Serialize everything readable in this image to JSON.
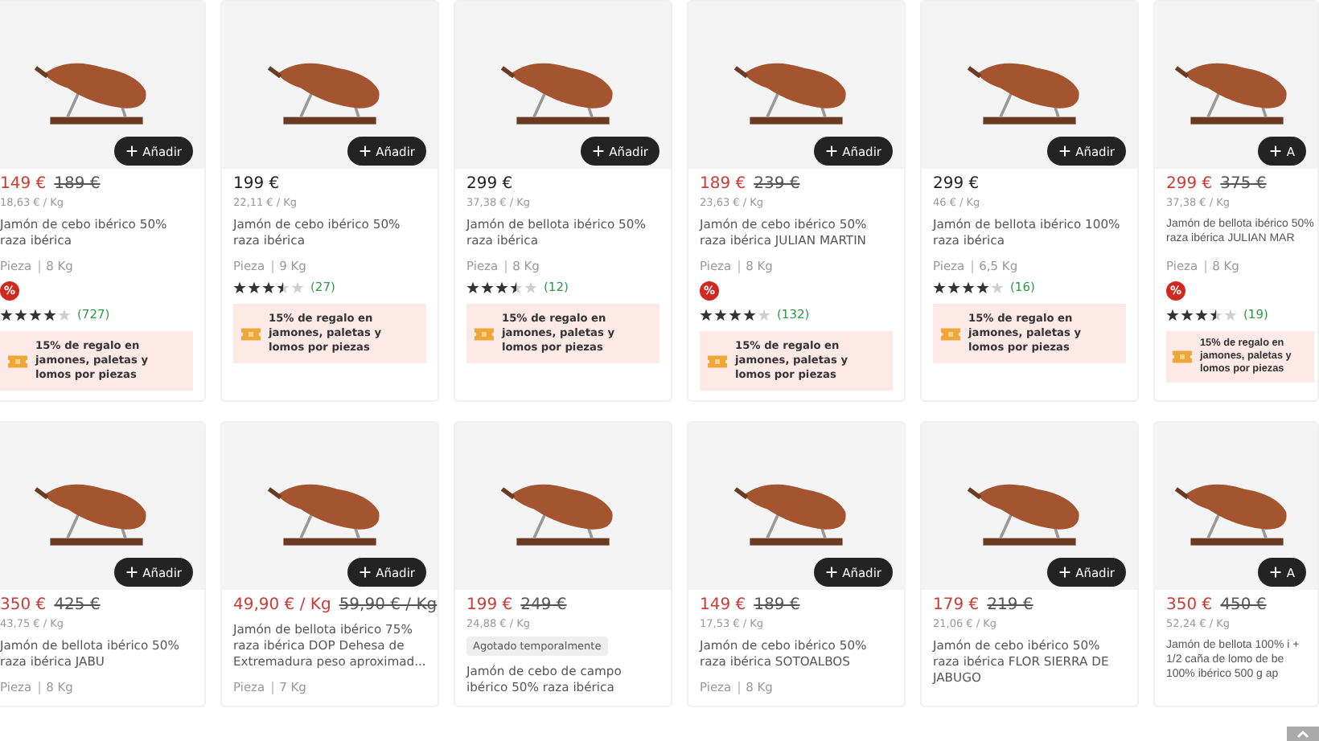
{
  "rows": [
    {
      "products": [
        {
          "price": "149 €",
          "old_price": "189 €",
          "unit_price": "18,63 € / Kg",
          "name": "Jamón de cebo ibérico 50% raza ibérica",
          "weight_label": "Pieza",
          "weight": "8 Kg",
          "discount_badge": "%",
          "stars": 4,
          "reviews": "(727)",
          "promo": "15% de regalo en jamones, paletas y lomos por piezas",
          "add_button": "Añadir"
        },
        {
          "price": "199 €",
          "unit_price": "22,11 € / Kg",
          "name": "Jamón de cebo ibérico 50% raza ibérica",
          "weight_label": "Pieza",
          "weight": "9 Kg",
          "stars": 3.5,
          "reviews": "(27)",
          "promo": "15% de regalo en jamones, paletas y lomos por piezas",
          "add_button": "Añadir"
        },
        {
          "price": "299 €",
          "unit_price": "37,38 € / Kg",
          "name": "Jamón de bellota ibérico 50% raza ibérica",
          "weight_label": "Pieza",
          "weight": "8 Kg",
          "stars": 3.5,
          "reviews": "(12)",
          "promo": "15% de regalo en jamones, paletas y lomos por piezas",
          "add_button": "Añadir"
        },
        {
          "price": "189 €",
          "old_price": "239 €",
          "unit_price": "23,63 € / Kg",
          "name": "Jamón de cebo ibérico 50% raza ibérica JULIAN MARTIN",
          "weight_label": "Pieza",
          "weight": "8 Kg",
          "discount_badge": "%",
          "stars": 4,
          "reviews": "(132)",
          "promo": "15% de regalo en jamones, paletas y lomos por piezas",
          "add_button": "Añadir"
        },
        {
          "price": "299 €",
          "unit_price": "46 € / Kg",
          "name": "Jamón de bellota ibérico 100% raza ibérica",
          "weight_label": "Pieza",
          "weight": "6,5 Kg",
          "stars": 4,
          "reviews": "(16)",
          "promo": "15% de regalo en jamones, paletas y lomos por piezas",
          "add_button": "Añadir"
        },
        {
          "price": "299 €",
          "old_price": "375 €",
          "unit_price": "37,38 € / Kg",
          "name": "Jamón de bellota ibérico 50% raza ibérica JULIAN MAR",
          "weight_label": "Pieza",
          "weight": "8 Kg",
          "discount_badge": "%",
          "stars": 3.5,
          "reviews": "(19)",
          "promo": "15% de regalo en jamones, paletas y lomos por piezas",
          "add_button": "A"
        }
      ]
    },
    {
      "products": [
        {
          "price": "350 €",
          "old_price": "425 €",
          "unit_price": "43,75 € / Kg",
          "name": "Jamón de bellota ibérico 50% raza ibérica JABU",
          "weight_label": "Pieza",
          "weight": "8 Kg",
          "add_button": "Añadir"
        },
        {
          "price": "49,90 € / Kg",
          "old_price": "59,90 € / Kg",
          "name": "Jamón de bellota ibérico 75% raza ibérica DOP Dehesa de Extremadura peso aproximad...",
          "weight_label": "Pieza",
          "weight": "7 Kg",
          "add_button": "Añadir"
        },
        {
          "price": "199 €",
          "old_price": "249 €",
          "unit_price": "24,88 € / Kg",
          "stock_label": "Agotado temporalmente",
          "name": "Jamón de cebo de campo ibérico 50% raza ibérica"
        },
        {
          "price": "149 €",
          "old_price": "189 €",
          "unit_price": "17,53 € / Kg",
          "name": "Jamón de cebo ibérico 50% raza ibérica SOTOALBOS",
          "weight_label": "Pieza",
          "weight": "8 Kg",
          "add_button": "Añadir"
        },
        {
          "price": "179 €",
          "old_price": "219 €",
          "unit_price": "21,06 € / Kg",
          "name": "Jamón de cebo ibérico 50% raza ibérica FLOR SIERRA DE JABUGO",
          "add_button": "Añadir"
        },
        {
          "price": "350 €",
          "old_price": "450 €",
          "unit_price": "52,24 € / Kg",
          "name": "Jamón de bellota 100% i + 1/2 caña de lomo de be 100% ibérico 500 g ap",
          "add_button": "A"
        }
      ]
    }
  ]
}
